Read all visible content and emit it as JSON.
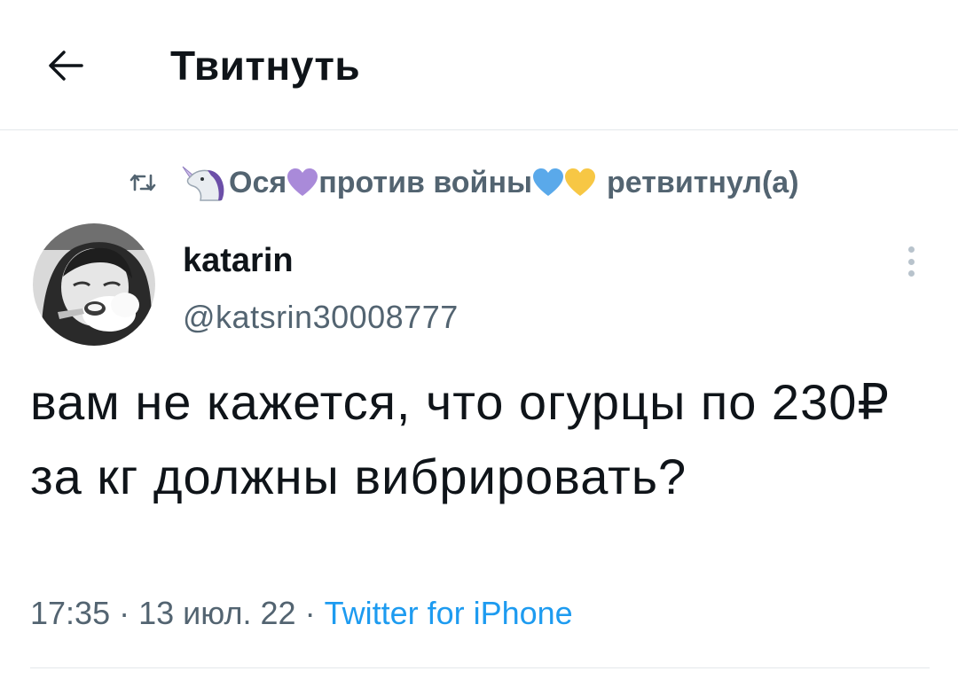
{
  "header": {
    "title": "Твитнуть",
    "back_icon": "arrow-left-icon"
  },
  "retweet": {
    "icon": "retweet-icon",
    "avatar_emoji": "unicorn-icon",
    "name_part1": "Ося",
    "name_part2": "против войны",
    "suffix": "ретвитнул(а)",
    "colors": {
      "purple_heart": "#a98ad9",
      "blue_heart": "#5aa9ea",
      "yellow_heart": "#f7c744"
    }
  },
  "tweet": {
    "author_name": "katarin",
    "author_handle": "@katsrin30008777",
    "text": "вам не кажется, что огурцы по 230₽ за кг должны вибрировать?",
    "time": "17:35",
    "date": "13 июл. 22",
    "separator": "·",
    "source": "Twitter for iPhone",
    "more_icon": "more-vertical-icon"
  },
  "colors": {
    "primary_text": "#0f1419",
    "secondary_text": "#536471",
    "accent": "#1d9bf0",
    "divider": "#e4e8eb"
  }
}
